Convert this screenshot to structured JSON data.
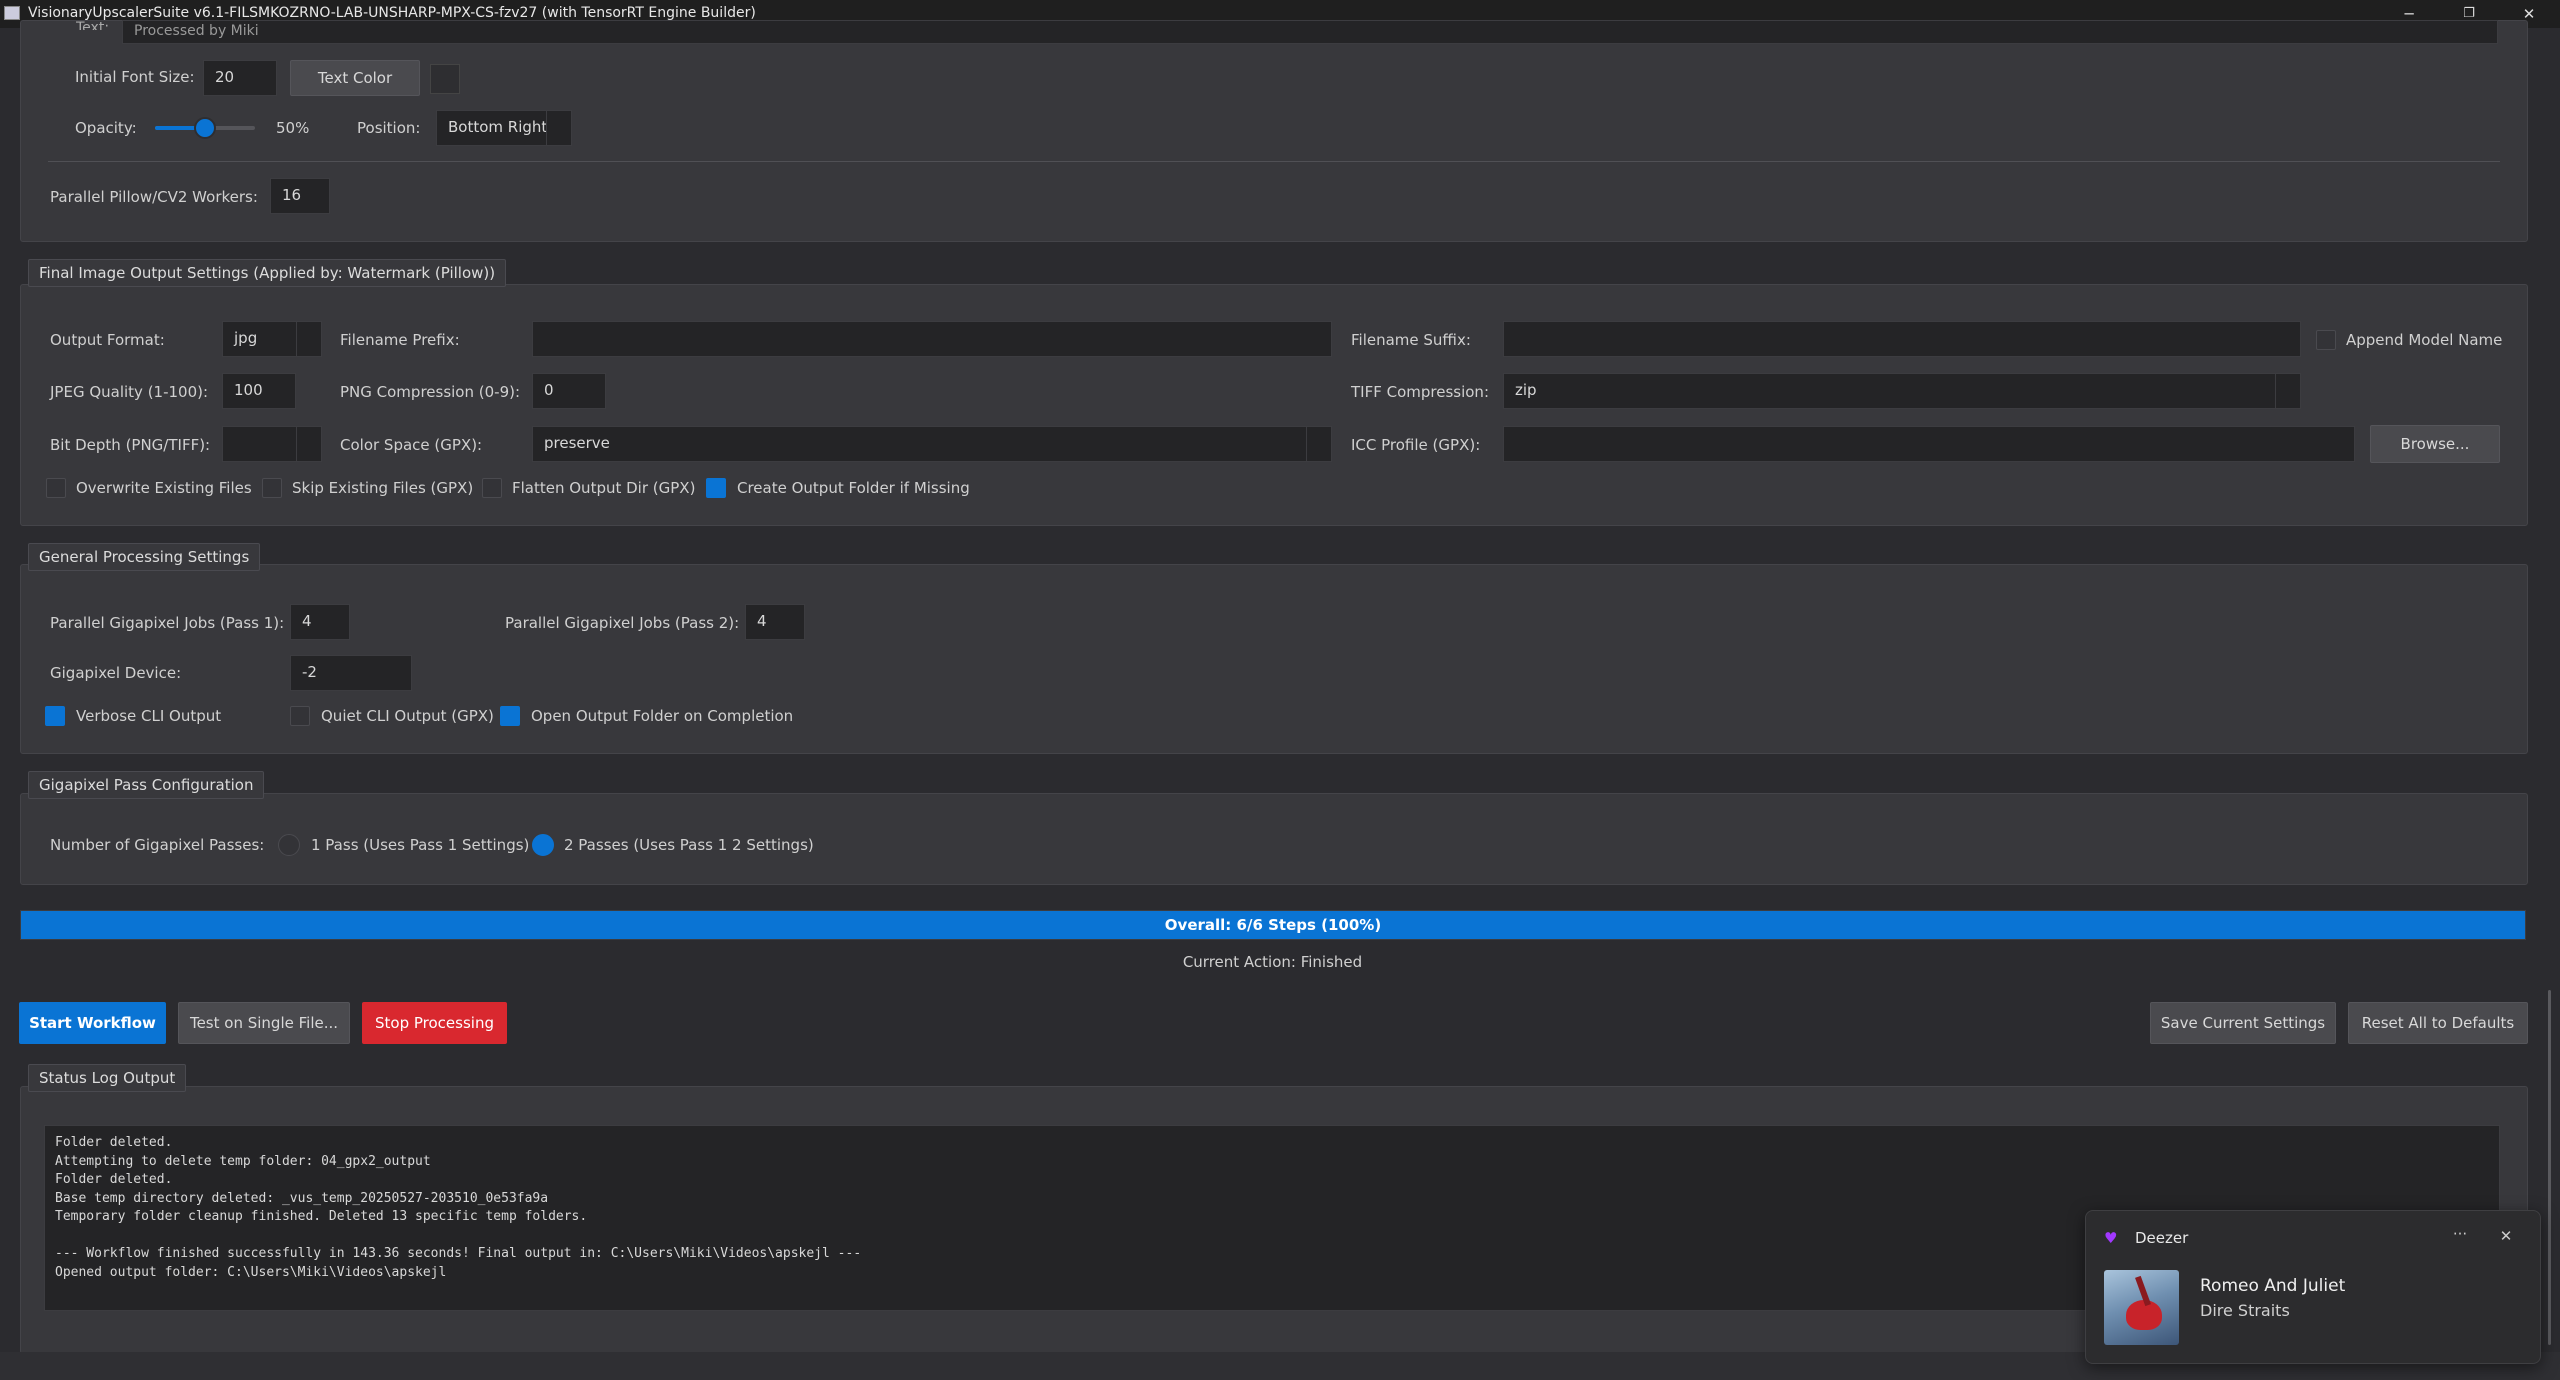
{
  "window": {
    "title": "VisionaryUpscalerSuite v6.1-FILSMKOZRNO-LAB-UNSHARP-MPX-CS-fzv27 (with TensorRT Engine Builder)",
    "minimize": "─",
    "maximize": "❐",
    "close": "✕"
  },
  "watermark": {
    "text_label": "Text:",
    "text_value": "Processed by Miki",
    "font_size_label": "Initial Font Size:",
    "font_size_value": "20",
    "text_color_button": "Text Color",
    "opacity_label": "Opacity:",
    "opacity_value": "50%",
    "opacity_level": 0.5,
    "position_label": "Position:",
    "position_value": "Bottom Right",
    "workers_label": "Parallel Pillow/CV2 Workers:",
    "workers_value": "16"
  },
  "output_settings": {
    "legend": "Final Image Output Settings (Applied by: Watermark (Pillow))",
    "output_format_label": "Output Format:",
    "output_format_value": "jpg",
    "prefix_label": "Filename Prefix:",
    "prefix_value": "",
    "suffix_label": "Filename Suffix:",
    "suffix_value": "",
    "append_model_label": "Append Model Name",
    "jpeg_quality_label": "JPEG Quality (1-100):",
    "jpeg_quality_value": "100",
    "png_compression_label": "PNG Compression (0-9):",
    "png_compression_value": "0",
    "tiff_compression_label": "TIFF Compression:",
    "tiff_compression_value": "zip",
    "bit_depth_label": "Bit Depth (PNG/TIFF):",
    "bit_depth_value": "",
    "color_space_label": "Color Space (GPX):",
    "color_space_value": "preserve",
    "icc_label": "ICC Profile (GPX):",
    "icc_value": "",
    "browse_button": "Browse...",
    "overwrite_label": "Overwrite Existing Files",
    "skip_label": "Skip Existing Files (GPX)",
    "flatten_label": "Flatten Output Dir (GPX)",
    "create_folder_label": "Create Output Folder if Missing"
  },
  "general": {
    "legend": "General Processing Settings",
    "jobs1_label": "Parallel Gigapixel Jobs (Pass 1):",
    "jobs1_value": "4",
    "jobs2_label": "Parallel Gigapixel Jobs (Pass 2):",
    "jobs2_value": "4",
    "device_label": "Gigapixel Device:",
    "device_value": "-2",
    "verbose_label": "Verbose CLI Output",
    "quiet_label": "Quiet CLI Output (GPX)",
    "open_folder_label": "Open Output Folder on Completion"
  },
  "passes": {
    "legend": "Gigapixel Pass Configuration",
    "count_label": "Number of Gigapixel Passes:",
    "one_pass_label": "1 Pass (Uses Pass 1 Settings)",
    "two_pass_label": "2 Passes (Uses Pass 1  2 Settings)"
  },
  "progress": {
    "text": "Overall: 6/6 Steps (100%)",
    "fraction": 1.0,
    "current_action": "Current Action: Finished"
  },
  "actions": {
    "start": "Start Workflow",
    "test": "Test on Single File...",
    "stop": "Stop Processing",
    "save": "Save Current Settings",
    "reset": "Reset All to Defaults"
  },
  "log": {
    "legend": "Status  Log Output",
    "lines": "Folder deleted.\nAttempting to delete temp folder: 04_gpx2_output\nFolder deleted.\nBase temp directory deleted: _vus_temp_20250527-203510_0e53fa9a\nTemporary folder cleanup finished. Deleted 13 specific temp folders.\n\n--- Workflow finished successfully in 143.36 seconds! Final output in: C:\\Users\\Miki\\Videos\\apskejl ---\nOpened output folder: C:\\Users\\Miki\\Videos\\apskejl"
  },
  "toast": {
    "app": "Deezer",
    "more": "···",
    "close": "✕",
    "song": "Romeo And Juliet",
    "artist": "Dire Straits"
  },
  "colors": {
    "accent": "#0a74d4",
    "stop": "#d9282f",
    "background": "#2b2b2f",
    "panel": "#38383c"
  }
}
